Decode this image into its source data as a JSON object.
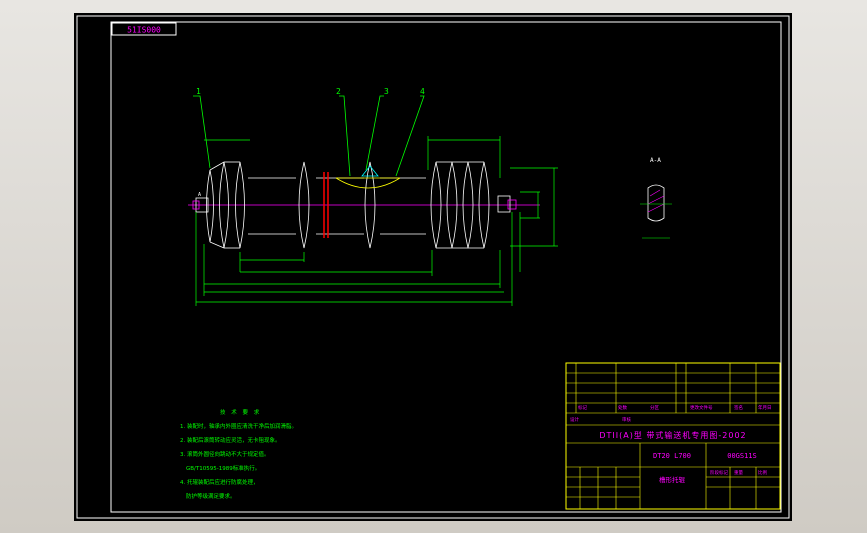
{
  "drawing": {
    "drawing_number_box": "51IS000",
    "balloons": [
      "1",
      "2",
      "3",
      "4"
    ],
    "section_label": "A-A",
    "section_marker": "A",
    "colors": {
      "paper": "#000000",
      "border": "#ffffff",
      "outline": "#ffffff",
      "dimension": "#00ff00",
      "centerline": "#ff00ff",
      "seal": "#ff0000",
      "text": "#ffff00",
      "title_text": "#ff00ff"
    }
  },
  "notes": {
    "heading": "技 术 要 求",
    "lines": [
      "1. 装配时，轴承内外圈应清洗干净后加润滑脂。",
      "2. 装配后滚筒转动应灵活，无卡阻现象。",
      "3. 滚筒外圆径向跳动不大于规定值。",
      "GB/T10595-1989标准执行。",
      "4. 托辊装配后应进行防腐处理，",
      "防护等级满足要求。"
    ]
  },
  "title_block": {
    "header": "DTII(A)型 带式输送机专用图-2002",
    "spec": "DT20 L700",
    "code": "00GS11S",
    "part_name": "槽形托辊",
    "rows_small": [
      "标记",
      "处数",
      "分区",
      "更改文件号",
      "签名",
      "年月日"
    ],
    "row_designer": "设计",
    "row_approve": "审核",
    "stage": "阶段标记",
    "weight": "重量",
    "scale": "比例"
  }
}
